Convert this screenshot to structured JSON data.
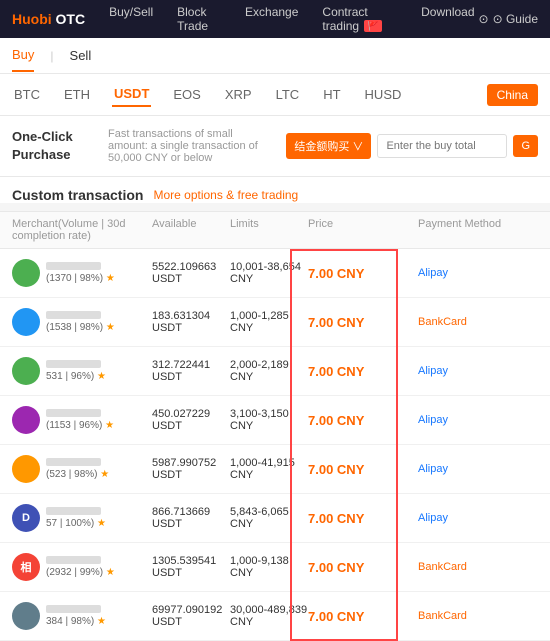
{
  "header": {
    "logo": "Huobi OTC",
    "nav": [
      {
        "label": "Buy/Sell",
        "active": false
      },
      {
        "label": "Block Trade",
        "active": false
      },
      {
        "label": "Exchange",
        "active": false
      },
      {
        "label": "Contract trading",
        "active": false,
        "badge": "🔴"
      },
      {
        "label": "Download",
        "active": false
      }
    ],
    "guide": "⊙ Guide"
  },
  "tabs": [
    {
      "label": "Buy",
      "active": true
    },
    {
      "label": "Sell",
      "active": false
    }
  ],
  "currencies": [
    {
      "label": "BTC"
    },
    {
      "label": "ETH"
    },
    {
      "label": "USDT",
      "active": true
    },
    {
      "label": "EOS"
    },
    {
      "label": "XRP"
    },
    {
      "label": "LTC"
    },
    {
      "label": "HT"
    },
    {
      "label": "HUSD"
    }
  ],
  "china_btn": "China",
  "one_click": {
    "label": "One-Click\nPurchase",
    "desc": "Fast transactions of small amount: a single transaction of 50,000 CNY or below",
    "amount_select": "结金额购买 ∨",
    "input_placeholder": "Enter the buy total",
    "go_btn": "G"
  },
  "custom_section": {
    "title": "Custom transaction",
    "subtitle": "More options & free trading"
  },
  "table": {
    "headers": [
      "Merchant(Volume | 30d completion rate)",
      "Available",
      "Limits",
      "Price",
      "Payment Method"
    ],
    "rows": [
      {
        "avatar_color": "#4CAF50",
        "avatar_letter": "",
        "merchant_stats": "(1370 | 98%)",
        "available": "5522.109663 USDT",
        "limits": "10,001-38,654 CNY",
        "price": "7.00 CNY",
        "payment": "Alipay",
        "payment_type": "alipay"
      },
      {
        "avatar_color": "#2196F3",
        "avatar_letter": "",
        "merchant_stats": "(1538 | 98%)",
        "available": "183.631304 USDT",
        "limits": "1,000-1,285 CNY",
        "price": "7.00 CNY",
        "payment": "BankCard",
        "payment_type": "bankcard"
      },
      {
        "avatar_color": "#4CAF50",
        "avatar_letter": "",
        "merchant_stats": "531 | 96%)",
        "available": "312.722441 USDT",
        "limits": "2,000-2,189 CNY",
        "price": "7.00 CNY",
        "payment": "Alipay",
        "payment_type": "alipay"
      },
      {
        "avatar_color": "#9C27B0",
        "avatar_letter": "",
        "merchant_stats": "(1153 | 96%)",
        "available": "450.027229 USDT",
        "limits": "3,100-3,150 CNY",
        "price": "7.00 CNY",
        "payment": "Alipay",
        "payment_type": "alipay"
      },
      {
        "avatar_color": "#FF9800",
        "avatar_letter": "",
        "merchant_stats": "(523 | 98%)",
        "available": "5987.990752 USDT",
        "limits": "1,000-41,915 CNY",
        "price": "7.00 CNY",
        "payment": "Alipay",
        "payment_type": "alipay"
      },
      {
        "avatar_color": "#3F51B5",
        "avatar_letter": "D",
        "merchant_stats": "57 | 100%)",
        "available": "866.713669 USDT",
        "limits": "5,843-6,065 CNY",
        "price": "7.00 CNY",
        "payment": "Alipay",
        "payment_type": "alipay"
      },
      {
        "avatar_color": "#F44336",
        "avatar_letter": "相",
        "merchant_stats": "(2932 | 99%)",
        "available": "1305.539541 USDT",
        "limits": "1,000-9,138 CNY",
        "price": "7.00 CNY",
        "payment": "BankCard",
        "payment_type": "bankcard"
      },
      {
        "avatar_color": "#607D8B",
        "avatar_letter": "",
        "merchant_stats": "384 | 98%)",
        "available": "69977.090192 USDT",
        "limits": "30,000-489,839 CNY",
        "price": "7.00 CNY",
        "payment": "BankCard",
        "payment_type": "bankcard"
      }
    ]
  }
}
